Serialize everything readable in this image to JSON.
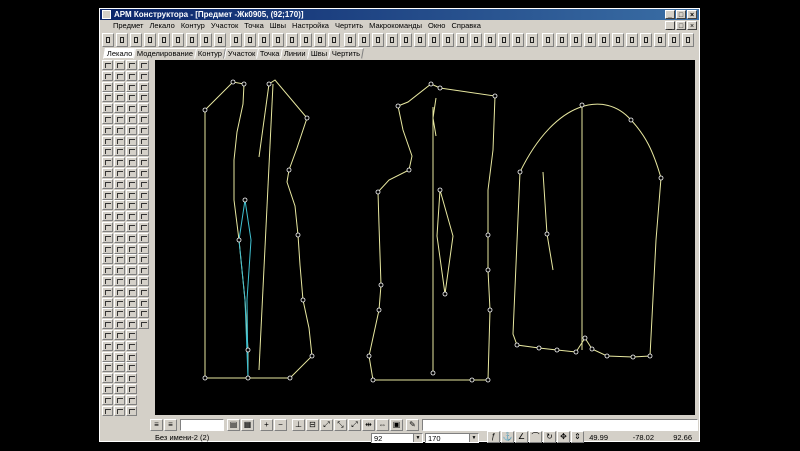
{
  "window": {
    "title": "АРМ Конструктора - [Предмет -Жк0905, (92;170)]",
    "caption_buttons": [
      "_",
      "□",
      "×"
    ]
  },
  "menu": [
    "Предмет",
    "Лекало",
    "Контур",
    "Участок",
    "Точка",
    "Швы",
    "Настройка",
    "Чертить",
    "Макрокоманды",
    "Окно",
    "Справка"
  ],
  "tabs": [
    "Лекало",
    "Моделирование",
    "Контур",
    "Участок",
    "Точка",
    "Линии",
    "Швы",
    "Чертить"
  ],
  "active_tab": "Лекало",
  "status": {
    "name": "Без имени-2 (2)",
    "size": "92",
    "height": "170",
    "x": "49.99",
    "y": "-78.02",
    "z": "92.66"
  },
  "colors": {
    "canvas_bg": "#000000",
    "pattern_line": "#e8e8a0",
    "dart_line": "#40c0d0",
    "point": "#ffffff",
    "chrome": "#d4d0c8",
    "title_start": "#0a246a",
    "title_end": "#3a6ea5"
  }
}
